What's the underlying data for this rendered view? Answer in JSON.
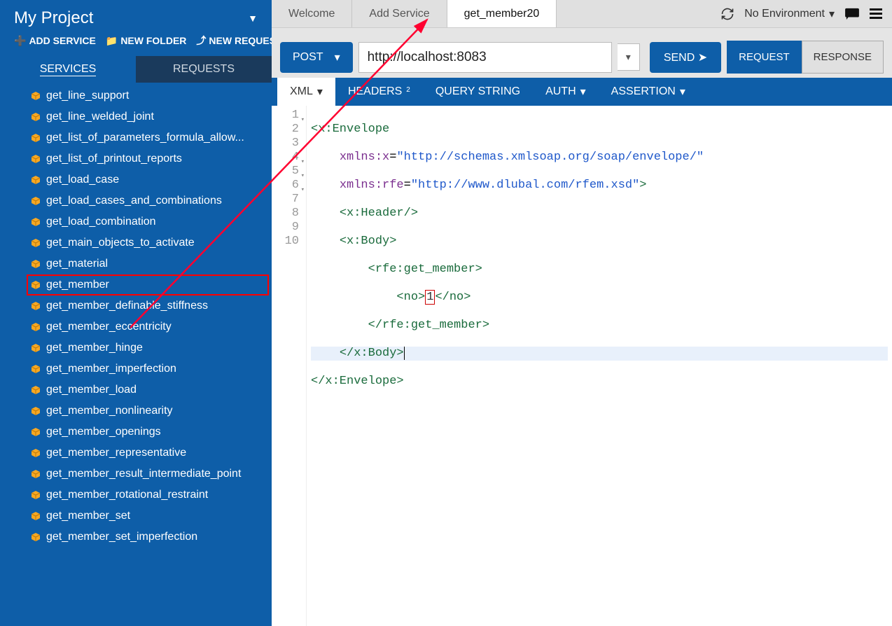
{
  "project": {
    "title": "My Project"
  },
  "actions": {
    "add_service": "ADD SERVICE",
    "new_folder": "NEW FOLDER",
    "new_request": "NEW REQUEST"
  },
  "sidebar_tabs": {
    "services": "SERVICES",
    "requests": "REQUESTS"
  },
  "services": [
    "get_line_support",
    "get_line_welded_joint",
    "get_list_of_parameters_formula_allow...",
    "get_list_of_printout_reports",
    "get_load_case",
    "get_load_cases_and_combinations",
    "get_load_combination",
    "get_main_objects_to_activate",
    "get_material",
    "get_member",
    "get_member_definable_stiffness",
    "get_member_eccentricity",
    "get_member_hinge",
    "get_member_imperfection",
    "get_member_load",
    "get_member_nonlinearity",
    "get_member_openings",
    "get_member_representative",
    "get_member_result_intermediate_point",
    "get_member_rotational_restraint",
    "get_member_set",
    "get_member_set_imperfection"
  ],
  "highlight_index": 9,
  "main_tabs": {
    "welcome": "Welcome",
    "add_service": "Add Service",
    "active": "get_member20"
  },
  "top_right": {
    "env": "No Environment"
  },
  "request": {
    "method": "POST",
    "url": "http://localhost:8083",
    "send": "SEND",
    "req_tab": "REQUEST",
    "res_tab": "RESPONSE"
  },
  "subtabs": {
    "xml": "XML",
    "headers": "HEADERS",
    "headers_count": "2",
    "query": "QUERY STRING",
    "auth": "AUTH",
    "assertion": "ASSERTION"
  },
  "code": {
    "no_value": "1",
    "lines": [
      "<x:Envelope",
      "    xmlns:x=\"http://schemas.xmlsoap.org/soap/envelope/\"",
      "    xmlns:rfe=\"http://www.dlubal.com/rfem.xsd\">",
      "    <x:Header/>",
      "    <x:Body>",
      "        <rfe:get_member>",
      "            <no>1</no>",
      "        </rfe:get_member>",
      "    </x:Body>",
      "</x:Envelope>"
    ]
  }
}
